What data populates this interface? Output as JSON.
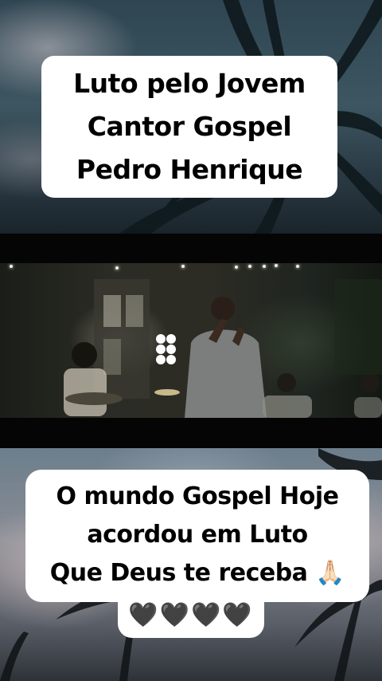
{
  "top_caption": {
    "lines": [
      "Luto pelo Jovem",
      "Cantor Gospel",
      "Pedro Henrique"
    ]
  },
  "bottom_caption": {
    "lines": [
      "O mundo Gospel Hoje",
      "acordou em Luto",
      "Que Deus te receba 🙏🏻"
    ],
    "hearts": "🖤🖤🖤🖤"
  },
  "colors": {
    "caption_bg": "#ffffff",
    "caption_text": "#000000",
    "band": "#050505"
  }
}
